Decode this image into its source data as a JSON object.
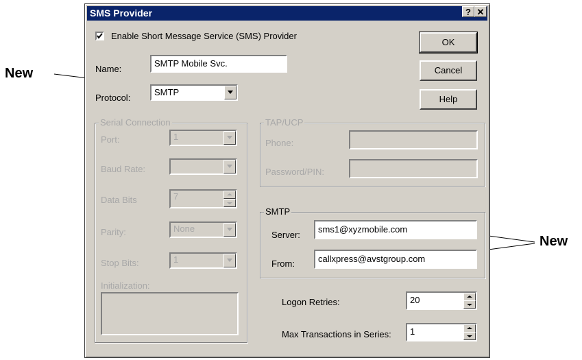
{
  "dialog": {
    "title": "SMS Provider",
    "help_glyph": "?",
    "close_glyph": "✕"
  },
  "enable_checkbox": {
    "label": "Enable Short Message Service (SMS) Provider",
    "checked": true
  },
  "name": {
    "label": "Name:",
    "value": "SMTP Mobile Svc."
  },
  "protocol": {
    "label": "Protocol:",
    "value": "SMTP"
  },
  "buttons": {
    "ok": "OK",
    "cancel": "Cancel",
    "help": "Help"
  },
  "serial": {
    "title": "Serial Connection",
    "port_label": "Port:",
    "port_value": "1",
    "baud_label": "Baud Rate:",
    "baud_value": "",
    "databits_label": "Data Bits",
    "databits_value": "7",
    "parity_label": "Parity:",
    "parity_value": "None",
    "stopbits_label": "Stop Bits:",
    "stopbits_value": "1",
    "init_label": "Initialization:"
  },
  "tap": {
    "title": "TAP/UCP",
    "phone_label": "Phone:",
    "phone_value": "",
    "password_label": "Password/PIN:",
    "password_value": ""
  },
  "smtp": {
    "title": "SMTP",
    "server_label": "Server:",
    "server_value": "sms1@xyzmobile.com",
    "from_label": "From:",
    "from_value": "callxpress@avstgroup.com"
  },
  "logon_retries": {
    "label": "Logon Retries:",
    "value": "20"
  },
  "max_transactions": {
    "label": "Max Transactions in Series:",
    "value": "1"
  },
  "annotations": {
    "left": "New",
    "right": "New"
  }
}
